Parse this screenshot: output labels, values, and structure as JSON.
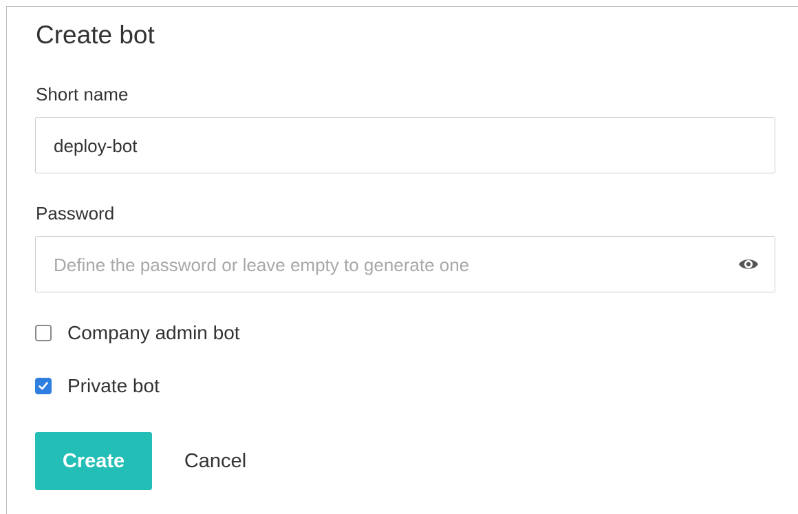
{
  "dialog": {
    "title": "Create bot"
  },
  "short_name": {
    "label": "Short name",
    "value": "deploy-bot"
  },
  "password": {
    "label": "Password",
    "placeholder": "Define the password or leave empty to generate one",
    "value": "",
    "icon": "eye-icon"
  },
  "options": {
    "company_admin": {
      "label": "Company admin bot",
      "checked": false
    },
    "private_bot": {
      "label": "Private bot",
      "checked": true
    }
  },
  "actions": {
    "create_label": "Create",
    "cancel_label": "Cancel"
  },
  "colors": {
    "primary_button": "#23beb5",
    "checkbox_checked": "#2f7fe0",
    "text": "#333333",
    "placeholder": "#a8a8a8",
    "border": "#cccccc"
  }
}
